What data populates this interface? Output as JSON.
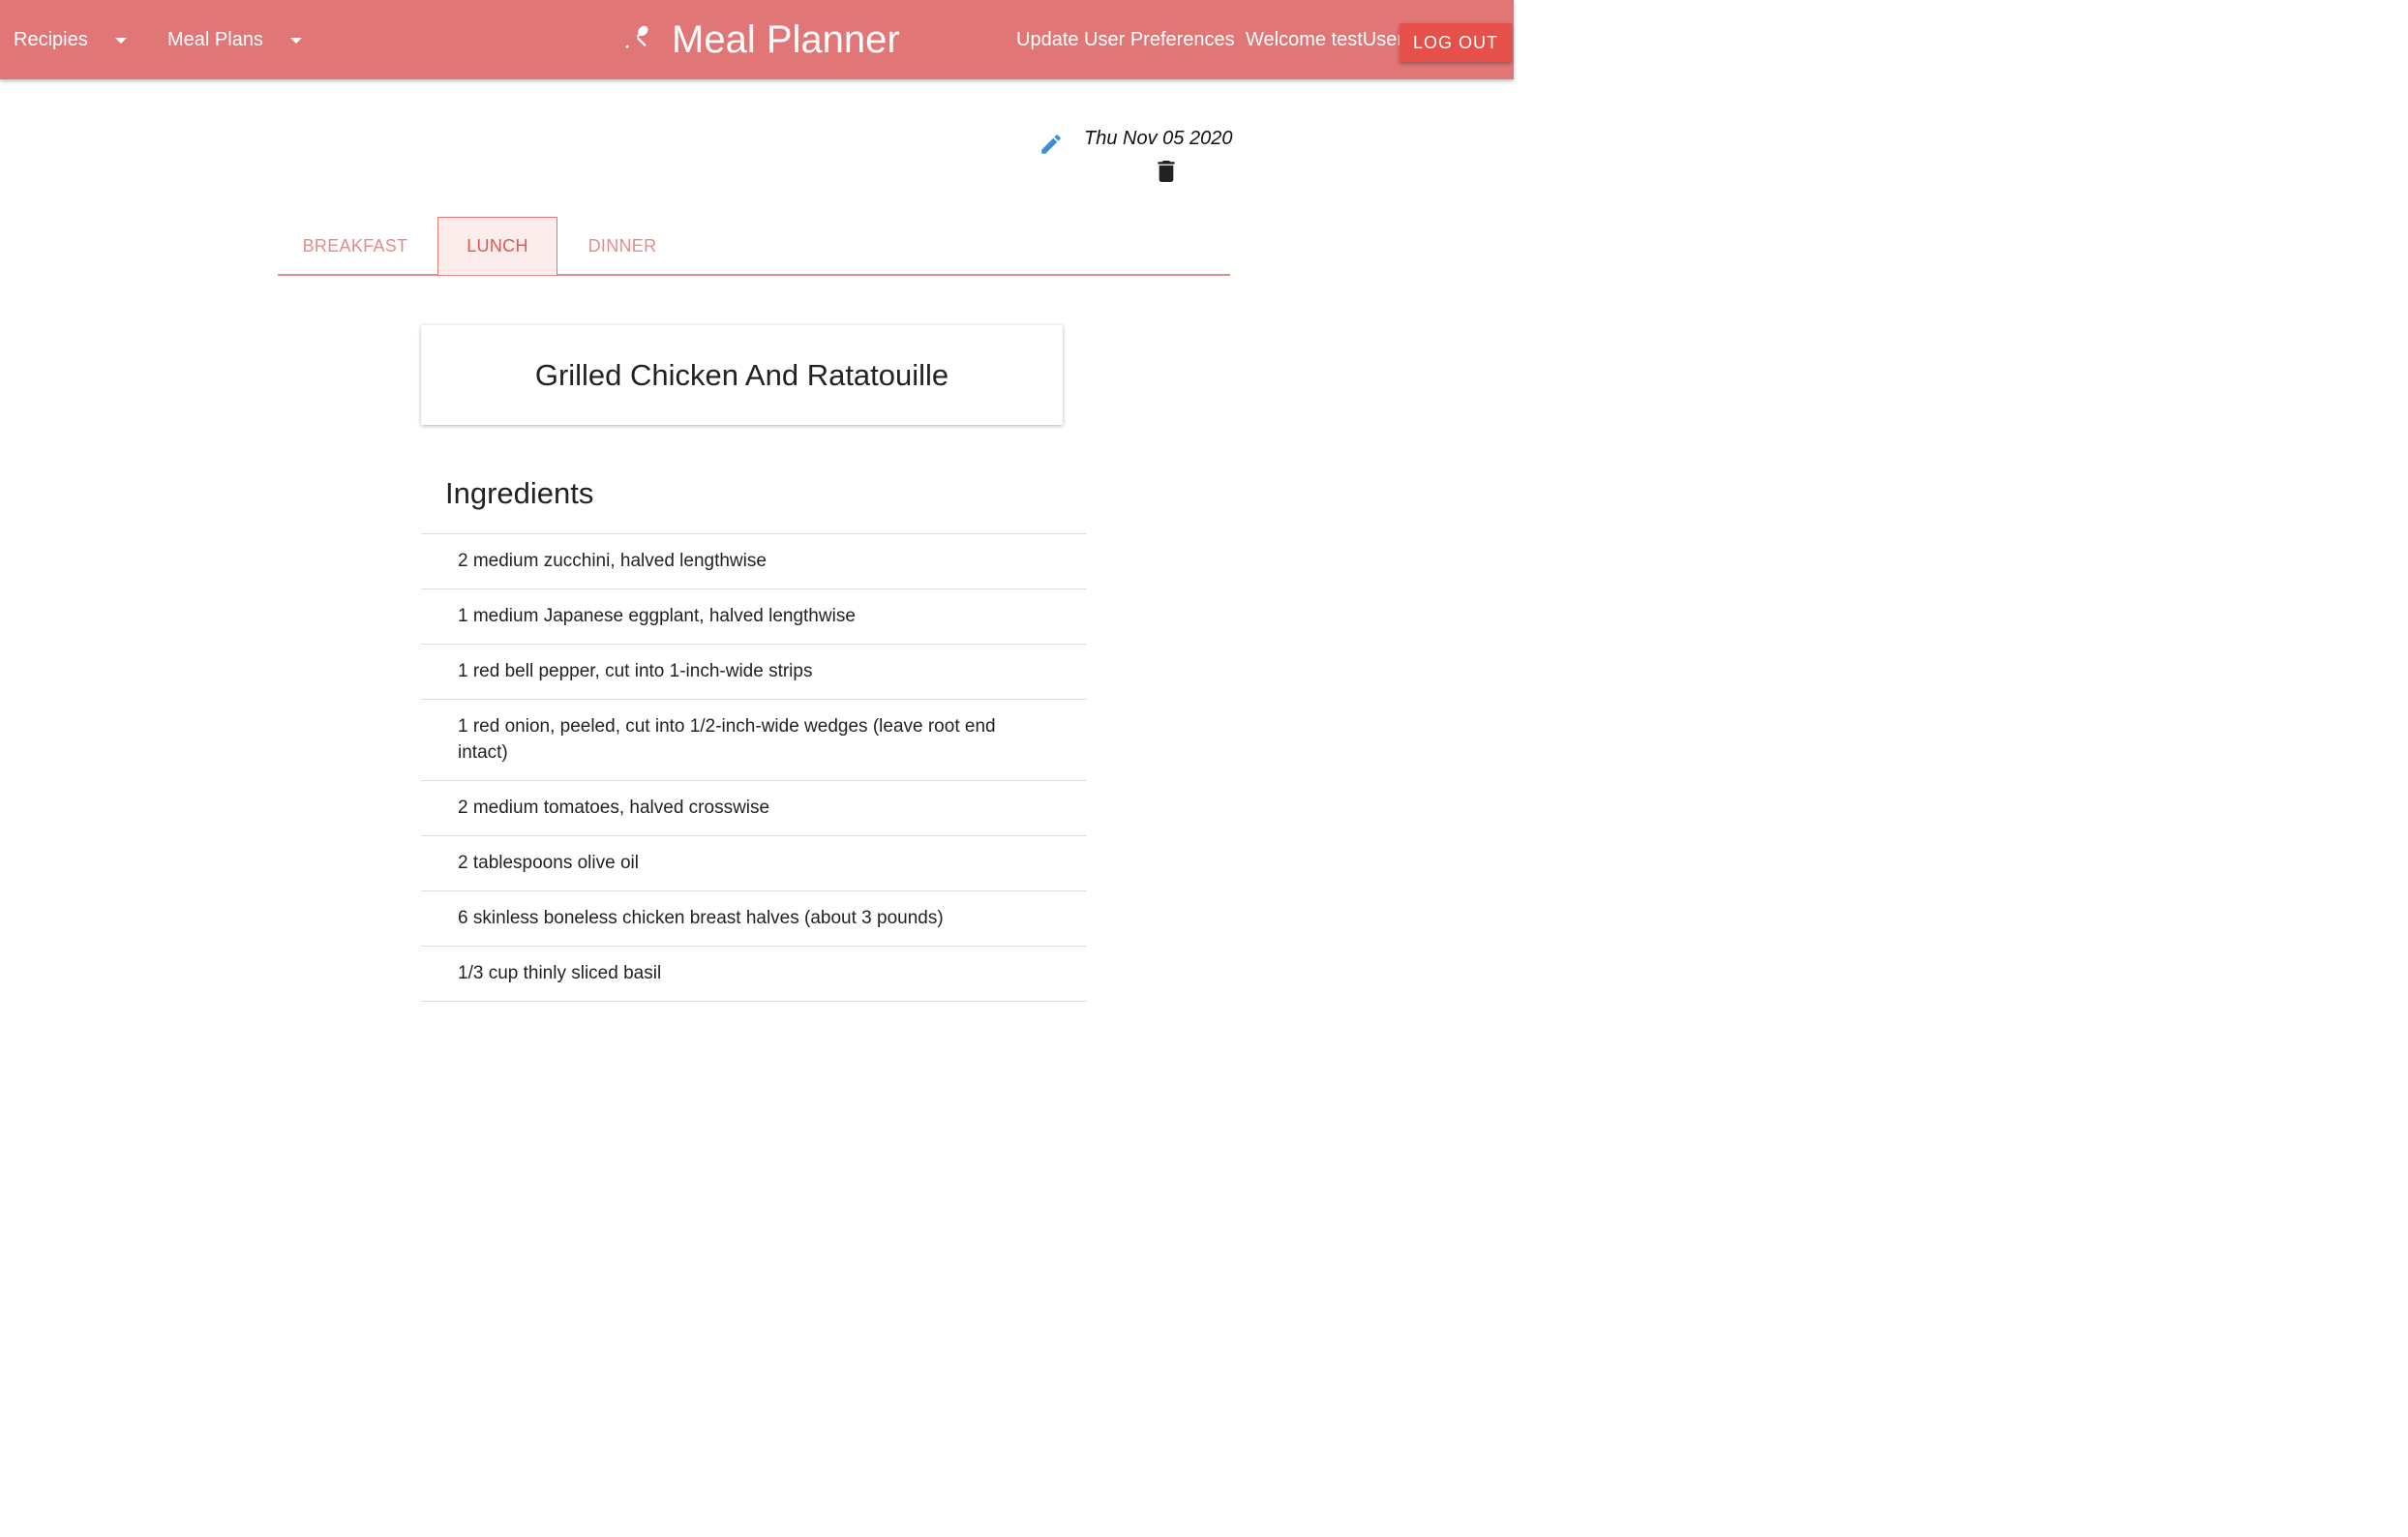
{
  "header": {
    "recipes_label": "Recipies",
    "meal_plans_label": "Meal Plans",
    "app_title": "Meal Planner",
    "brand_icon": "fork-knife-icon",
    "update_prefs_label": "Update User Preferences",
    "welcome_text": "Welcome testUser",
    "logout_label": "LOG OUT"
  },
  "plan": {
    "date": "Thu Nov 05 2020",
    "edit_icon": "pencil-icon",
    "delete_icon": "trash-icon"
  },
  "tabs": [
    {
      "label": "BREAKFAST",
      "active": false
    },
    {
      "label": "LUNCH",
      "active": true
    },
    {
      "label": "DINNER",
      "active": false
    }
  ],
  "recipe": {
    "title": "Grilled Chicken And Ratatouille",
    "ingredients_heading": "Ingredients",
    "ingredients": [
      "2 medium zucchini, halved lengthwise",
      "1 medium Japanese eggplant, halved lengthwise",
      "1 red bell pepper, cut into 1-inch-wide strips",
      "1 red onion, peeled, cut into 1/2-inch-wide wedges (leave root end intact)",
      "2 medium tomatoes, halved crosswise",
      "2 tablespoons olive oil",
      "6 skinless boneless chicken breast halves (about 3 pounds)",
      "1/3 cup thinly sliced basil"
    ]
  },
  "colors": {
    "navbar": "#e07676",
    "logout_button": "#e5514a",
    "tab_text": "#e88a8a",
    "edit_icon": "#3a8fd6"
  }
}
